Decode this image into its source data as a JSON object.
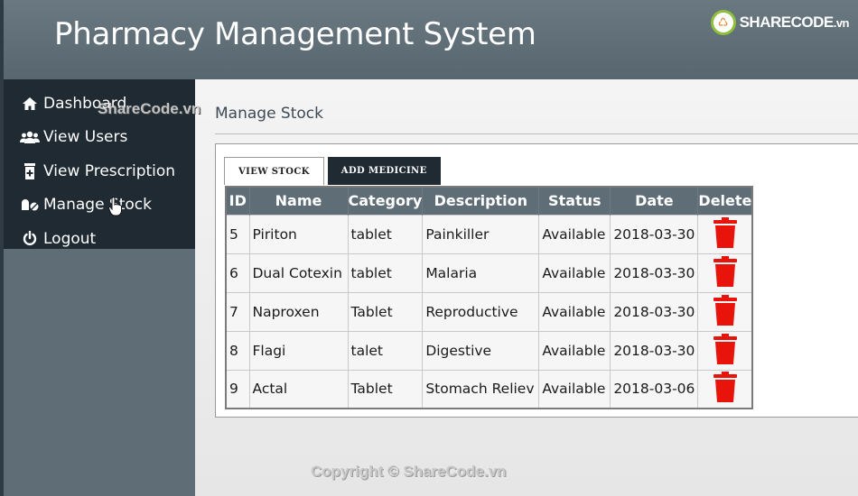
{
  "header": {
    "title": "Pharmacy Management System"
  },
  "watermark": {
    "logo_text": "SHARECODE",
    "logo_domain": ".vn",
    "overlay": "ShareCode.vn",
    "footer": "Copyright © ShareCode.vn"
  },
  "sidebar": {
    "items": [
      {
        "label": "Dashboard",
        "icon": "home-icon"
      },
      {
        "label": "View Users",
        "icon": "users-icon"
      },
      {
        "label": "View Prescription",
        "icon": "prescription-icon"
      },
      {
        "label": "Manage Stock",
        "icon": "pills-icon"
      },
      {
        "label": "Logout",
        "icon": "power-icon"
      }
    ]
  },
  "main": {
    "heading": "Manage Stock",
    "tabs": [
      {
        "label": "VIEW STOCK",
        "active": true
      },
      {
        "label": "ADD MEDICINE",
        "active": false
      }
    ],
    "table": {
      "headers": [
        "ID",
        "Name",
        "Category",
        "Description",
        "Status",
        "Date",
        "Delete"
      ],
      "rows": [
        {
          "id": "5",
          "name": "Piriton",
          "category": "tablet",
          "description": "Painkiller",
          "status": "Available",
          "date": "2018-03-30"
        },
        {
          "id": "6",
          "name": "Dual Cotexin",
          "category": "tablet",
          "description": "Malaria",
          "status": "Available",
          "date": "2018-03-30"
        },
        {
          "id": "7",
          "name": "Naproxen",
          "category": "Tablet",
          "description": "Reproductive",
          "status": "Available",
          "date": "2018-03-30"
        },
        {
          "id": "8",
          "name": "Flagi",
          "category": "talet",
          "description": "Digestive",
          "status": "Available",
          "date": "2018-03-30"
        },
        {
          "id": "9",
          "name": "Actal",
          "category": "Tablet",
          "description": "Stomach Reliev",
          "status": "Available",
          "date": "2018-03-06"
        }
      ]
    }
  },
  "colors": {
    "header": "#5f6d77",
    "sidebar_menu": "#1f2a33",
    "delete": "#e8140c"
  }
}
